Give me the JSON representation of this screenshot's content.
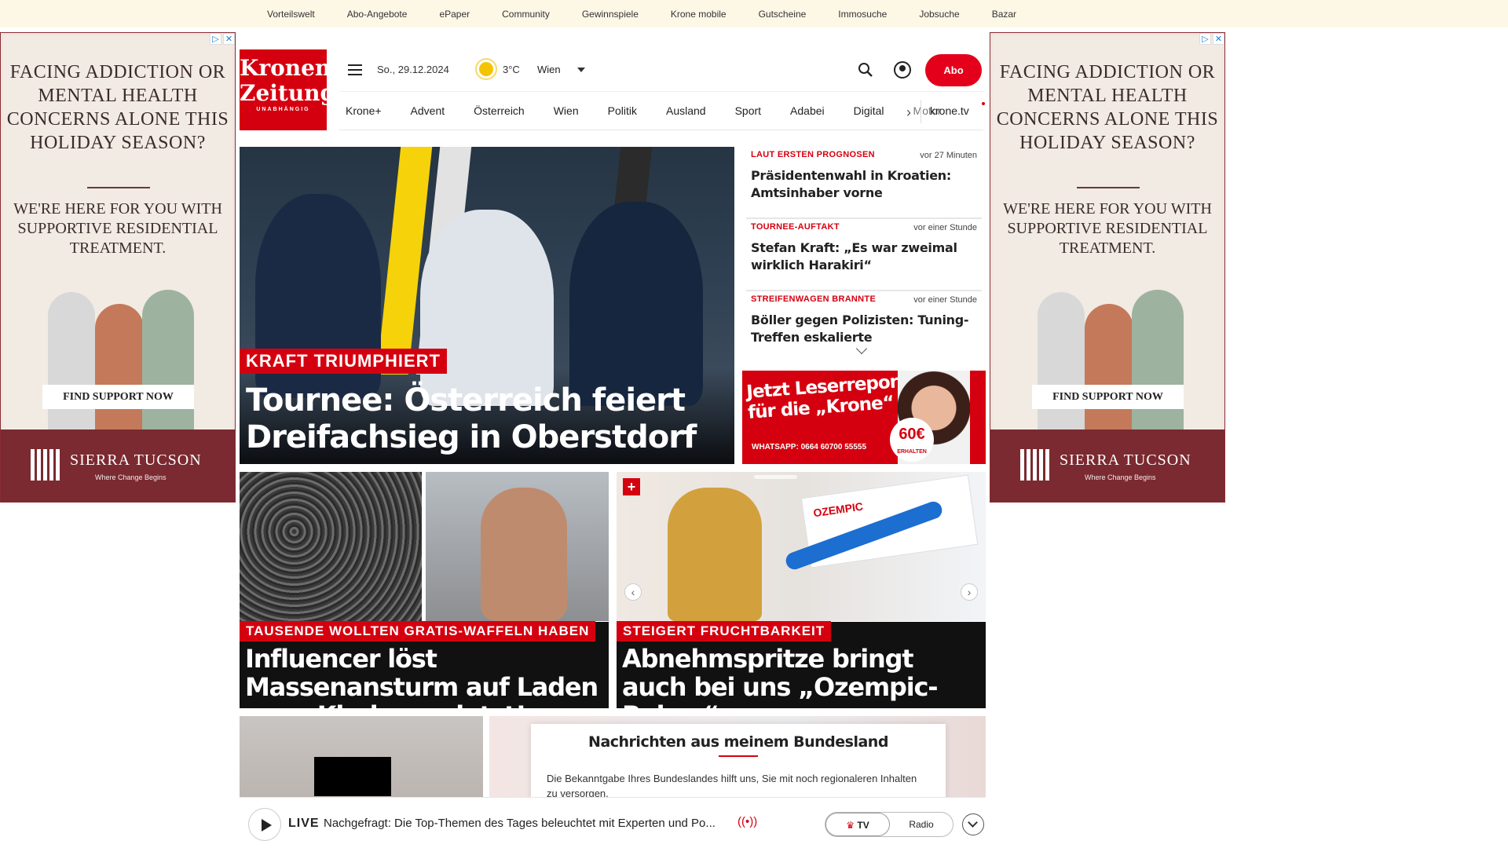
{
  "topnav": [
    "Vorteilswelt",
    "Abo-Angebote",
    "ePaper",
    "Community",
    "Gewinnspiele",
    "Krone mobile",
    "Gutscheine",
    "Immosuche",
    "Jobsuche",
    "Bazar"
  ],
  "ad": {
    "headline": "FACING ADDICTION OR MENTAL HEALTH CONCERNS ALONE THIS HOLIDAY SEASON?",
    "sub": "WE'RE HERE FOR YOU WITH SUPPORTIVE RESIDENTIAL TREATMENT.",
    "cta": "FIND SUPPORT NOW",
    "brand": "SIERRA TUCSON",
    "tagline": "Where Change Begins"
  },
  "header": {
    "logo_line1": "Kronen",
    "logo_line2": "Zeitung",
    "logo_sub": "UNABHÄNGIG",
    "date": "So., 29.12.2024",
    "temperature": "3°C",
    "city": "Wien",
    "abo_label": "Abo"
  },
  "nav": [
    "Krone+",
    "Advent",
    "Österreich",
    "Wien",
    "Politik",
    "Ausland",
    "Sport",
    "Adabei",
    "Digital",
    "Motor"
  ],
  "nav_tv": "krone.tv",
  "hero": {
    "kicker": "KRAFT TRIUMPHIERT",
    "headline": "Tournee: Österreich feiert Dreifachsieg in Oberstdorf"
  },
  "news": [
    {
      "kicker": "LAUT ERSTEN PROGNOSEN",
      "time": "vor 27 Minuten",
      "headline": "Präsidentenwahl in Kroatien: Amtsinhaber vorne"
    },
    {
      "kicker": "TOURNEE-AUFTAKT",
      "time": "vor einer Stunde",
      "headline": "Stefan Kraft: „Es war zweimal wirklich Harakiri“"
    },
    {
      "kicker": "STREIFENWAGEN BRANNTE",
      "time": "vor einer Stunde",
      "headline": "Böller gegen Polizisten: Tuning-Treffen eskalierte"
    }
  ],
  "promo": {
    "line1": "Jetzt Leserreporter",
    "line2": "für die „Krone“ werden",
    "whatsapp": "WHATSAPP: 0664 60700 55555",
    "badge": "60€",
    "badge_sub": "ERHALTEN"
  },
  "cards": [
    {
      "kicker": "TAUSENDE WOLLTEN GRATIS-WAFFELN HABEN",
      "headline": "Influencer löst Massenansturm auf Laden aus - Kinder verletzt!"
    },
    {
      "kicker": "STEIGERT FRUCHTBARKEIT",
      "headline": "Abnehmspritze bringt auch bei uns „Ozempic-Babys“",
      "box_text": "OZEMPIC"
    }
  ],
  "modal": {
    "title": "Nachrichten aus meinem Bundesland",
    "text": "Die Bekanntgabe Ihres Bundeslandes hilft uns, Sie mit noch regionaleren Inhalten zu versorgen."
  },
  "player": {
    "live": "LIVE",
    "title": "Nachgefragt: Die Top-Themen des Tages beleuchtet mit Experten und Po...",
    "tv": "TV",
    "radio": "Radio"
  }
}
